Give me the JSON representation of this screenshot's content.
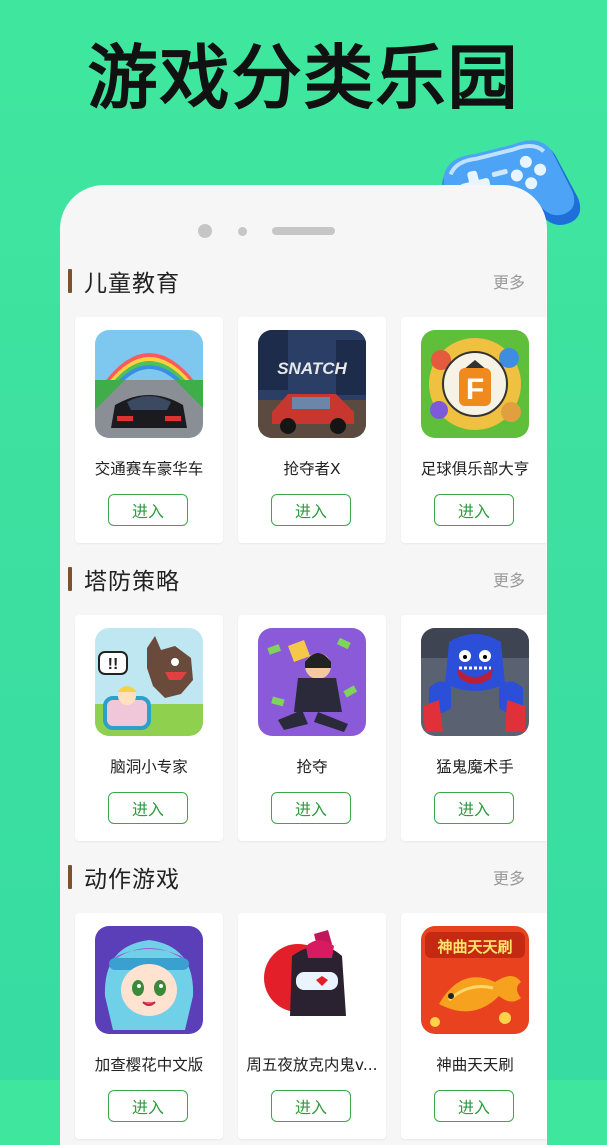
{
  "headline": "游戏分类乐园",
  "sections": [
    {
      "title": "儿童教育",
      "more": "更多",
      "games": [
        {
          "name": "交通赛车豪华车",
          "button": "进入",
          "icon": "racing-car-icon"
        },
        {
          "name": "抢夺者X",
          "button": "进入",
          "icon": "snatch-car-icon",
          "image_text": "SNATCH"
        },
        {
          "name": "足球俱乐部大亨",
          "button": "进入",
          "icon": "soccer-club-icon",
          "image_text": "F"
        }
      ]
    },
    {
      "title": "塔防策略",
      "more": "更多",
      "games": [
        {
          "name": "脑洞小专家",
          "button": "进入",
          "icon": "wolf-cartoon-icon",
          "image_text": "!!"
        },
        {
          "name": "抢夺",
          "button": "进入",
          "icon": "robber-cash-icon"
        },
        {
          "name": "猛鬼魔术手",
          "button": "进入",
          "icon": "blue-monster-icon"
        }
      ]
    },
    {
      "title": "动作游戏",
      "more": "更多",
      "games": [
        {
          "name": "加查樱花中文版",
          "button": "进入",
          "icon": "anime-girl-icon"
        },
        {
          "name": "周五夜放克内鬼v...",
          "button": "进入",
          "icon": "impostor-icon"
        },
        {
          "name": "神曲天天刷",
          "button": "进入",
          "icon": "golden-fish-icon",
          "image_text": "神曲天天刷"
        }
      ]
    }
  ],
  "colors": {
    "background": "#3fe79e",
    "accent_green": "#3aa84a",
    "section_bar": "#7a5230"
  }
}
